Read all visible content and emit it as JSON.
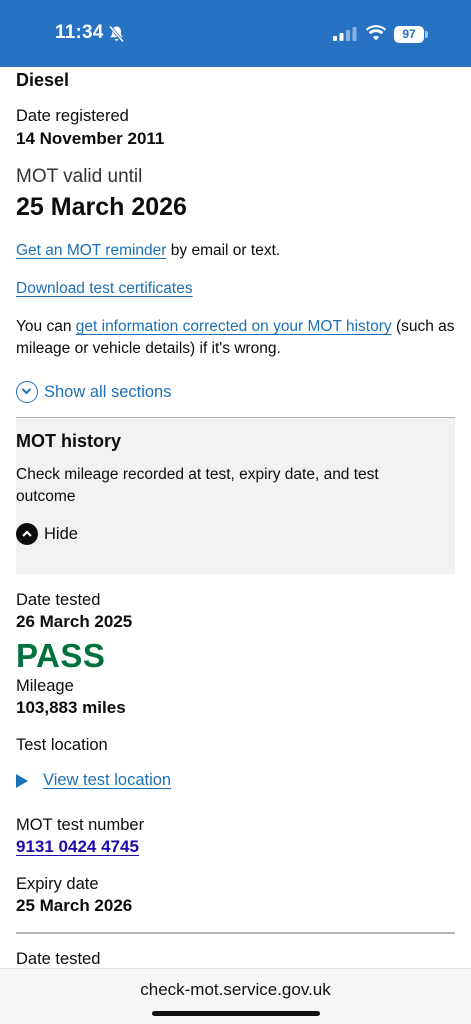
{
  "status_bar": {
    "time": "11:34",
    "battery": "97",
    "icons": [
      "bell-slash-icon",
      "cellular-signal-icon",
      "wifi-icon",
      "battery-icon"
    ]
  },
  "vehicle": {
    "fuel_type": "Diesel",
    "date_registered_label": "Date registered",
    "date_registered": "14 November 2011",
    "mot_valid_label": "MOT valid until",
    "mot_valid_until": "25 March 2026"
  },
  "links": {
    "reminder_link": "Get an MOT reminder",
    "reminder_suffix": " by email or text.",
    "download_certificates": "Download test certificates",
    "correction_prefix": "You can ",
    "correction_link": "get information corrected on your MOT history",
    "correction_suffix": " (such as mileage or vehicle details) if it's wrong."
  },
  "accordion": {
    "show_all": "Show all sections"
  },
  "mot_history": {
    "title": "MOT history",
    "description": "Check mileage recorded at test, expiry date, and test outcome",
    "hide_label": "Hide"
  },
  "test": {
    "date_tested_label": "Date tested",
    "date_tested": "26 March 2025",
    "result": "PASS",
    "mileage_label": "Mileage",
    "mileage": "103,883 miles",
    "location_label": "Test location",
    "view_location": "View test location",
    "test_number_label": "MOT test number",
    "test_number": "9131 0424 4745",
    "expiry_label": "Expiry date",
    "expiry_date": "25 March 2026"
  },
  "next_test": {
    "date_tested_label": "Date tested"
  },
  "browser": {
    "url": "check-mot.service.gov.uk"
  },
  "colors": {
    "header": "#2872c4",
    "link": "#1d70b8",
    "pass": "#00703c",
    "panel": "#f3f2f1"
  }
}
